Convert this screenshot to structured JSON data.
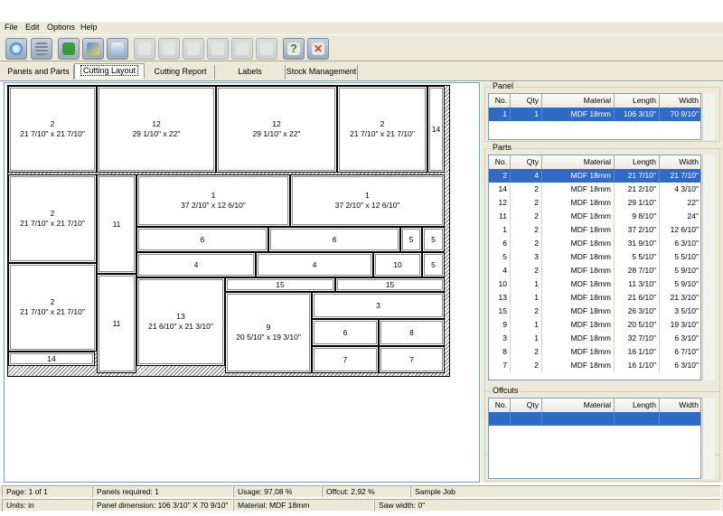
{
  "menu": [
    "File",
    "Edit",
    "Options",
    "Help"
  ],
  "toolbar": [
    {
      "icon": "optimize-icon",
      "enabled": true
    },
    {
      "icon": "database-icon",
      "enabled": true
    },
    {
      "icon": "export-icon",
      "enabled": true
    },
    {
      "icon": "edit-icon",
      "enabled": true
    },
    {
      "icon": "print-icon",
      "enabled": true
    },
    {
      "icon": "first-icon",
      "enabled": false
    },
    {
      "icon": "previous-icon",
      "enabled": false
    },
    {
      "icon": "next-icon",
      "enabled": false
    },
    {
      "icon": "last-icon",
      "enabled": false
    },
    {
      "icon": "plus-icon",
      "enabled": false
    },
    {
      "icon": "minus-icon",
      "enabled": false
    },
    {
      "icon": "help-icon",
      "enabled": true
    },
    {
      "icon": "exit-icon",
      "enabled": true
    }
  ],
  "tabs": [
    "Panels and Parts",
    "Cutting Layout",
    "Cutting Report",
    "Labels",
    "Stock Management"
  ],
  "active_tab": 1,
  "layout_parts": [
    {
      "n": "2",
      "d": "21 7/10\" x 21 7/10\""
    },
    {
      "n": "12",
      "d": "29 1/10\" x 22\""
    },
    {
      "n": "12",
      "d": "29 1/10\" x 22\""
    },
    {
      "n": "2",
      "d": "21 7/10\" x 21 7/10\""
    },
    {
      "n": "14",
      "d": ""
    },
    {
      "n": "2",
      "d": "21 7/10\" x 21 7/10\""
    },
    {
      "n": "11",
      "d": ""
    },
    {
      "n": "1",
      "d": "37 2/10\" x 12 6/10\""
    },
    {
      "n": "1",
      "d": "37 2/10\" x 12 6/10\""
    },
    {
      "n": "6",
      "d": ""
    },
    {
      "n": "6",
      "d": ""
    },
    {
      "n": "5",
      "d": ""
    },
    {
      "n": "5",
      "d": ""
    },
    {
      "n": "4",
      "d": ""
    },
    {
      "n": "4",
      "d": ""
    },
    {
      "n": "10",
      "d": ""
    },
    {
      "n": "5",
      "d": ""
    },
    {
      "n": "15",
      "d": ""
    },
    {
      "n": "15",
      "d": ""
    },
    {
      "n": "2",
      "d": "21 7/10\" x 21 7/10\""
    },
    {
      "n": "11",
      "d": ""
    },
    {
      "n": "13",
      "d": "21 6/10\" x 21 3/10\""
    },
    {
      "n": "9",
      "d": "20 5/10\" x 19 3/10\""
    },
    {
      "n": "3",
      "d": ""
    },
    {
      "n": "6",
      "d": ""
    },
    {
      "n": "8",
      "d": ""
    },
    {
      "n": "7",
      "d": ""
    },
    {
      "n": "7",
      "d": ""
    },
    {
      "n": "14",
      "d": ""
    }
  ],
  "panel": {
    "title": "Panel",
    "columns": [
      "No.",
      "Qty",
      "Material",
      "Length",
      "Width"
    ],
    "rows": [
      [
        "1",
        "1",
        "MDF 18mm",
        "106 3/10\"",
        "70 9/10\""
      ]
    ],
    "selected": 0
  },
  "parts": {
    "title": "Parts",
    "columns": [
      "No.",
      "Qty",
      "Material",
      "Length",
      "Width"
    ],
    "rows": [
      [
        "2",
        "4",
        "MDF 18mm",
        "21 7/10\"",
        "21 7/10\""
      ],
      [
        "14",
        "2",
        "MDF 18mm",
        "21 2/10\"",
        "4 3/10\""
      ],
      [
        "12",
        "2",
        "MDF 18mm",
        "29 1/10\"",
        "22\""
      ],
      [
        "11",
        "2",
        "MDF 18mm",
        "9 8/10\"",
        "24\""
      ],
      [
        "1",
        "2",
        "MDF 18mm",
        "37 2/10\"",
        "12 6/10\""
      ],
      [
        "6",
        "2",
        "MDF 18mm",
        "31 9/10\"",
        "6 3/10\""
      ],
      [
        "5",
        "3",
        "MDF 18mm",
        "5 5/10\"",
        "5 5/10\""
      ],
      [
        "4",
        "2",
        "MDF 18mm",
        "28 7/10\"",
        "5 9/10\""
      ],
      [
        "10",
        "1",
        "MDF 18mm",
        "11 3/10\"",
        "5 9/10\""
      ],
      [
        "13",
        "1",
        "MDF 18mm",
        "21 6/10\"",
        "21 3/10\""
      ],
      [
        "15",
        "2",
        "MDF 18mm",
        "26 3/10\"",
        "3 5/10\""
      ],
      [
        "9",
        "1",
        "MDF 18mm",
        "20 5/10\"",
        "19 3/10\""
      ],
      [
        "3",
        "1",
        "MDF 18mm",
        "32 7/10\"",
        "6 3/10\""
      ],
      [
        "8",
        "2",
        "MDF 18mm",
        "16 1/10\"",
        "6 7/10\""
      ],
      [
        "7",
        "2",
        "MDF 18mm",
        "16 1/10\"",
        "6 3/10\""
      ]
    ],
    "selected": 0
  },
  "offcuts": {
    "title": "Offcuts",
    "columns": [
      "No.",
      "Qty",
      "Material",
      "Length",
      "Width"
    ],
    "rows": [
      [
        "",
        "",
        "",
        "",
        ""
      ]
    ],
    "selected": 0
  },
  "status": {
    "page": "Page: 1 of 1",
    "panels_required": "Panels required: 1",
    "usage": "Usage: 97,08 %",
    "offcut": "Offcut: 2,92 %",
    "job": "Sample Job",
    "units": "Units: in",
    "panel_dimension": "Panel dimension: 106 3/10\" X 70 9/10\"",
    "material": "Material: MDF 18mm",
    "saw_width": "Saw width: 0\""
  },
  "colors": {
    "selection": "#316ac5",
    "window": "#ece9d8"
  }
}
